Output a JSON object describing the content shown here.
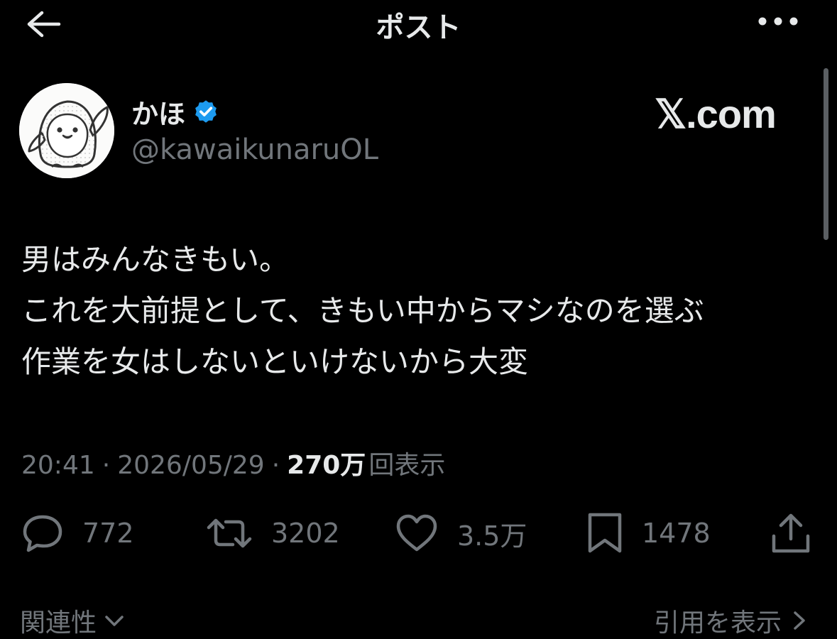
{
  "header": {
    "title": "ポスト",
    "back_icon": "arrow-left-icon",
    "more_icon": "more-horizontal-icon"
  },
  "author": {
    "display_name": "かほ",
    "handle": "@kawaikunaruOL",
    "verified_color": "#1d9bf0"
  },
  "watermark": "𝕏.com",
  "tweet": {
    "lines": [
      "男はみんなきもい。",
      "これを大前提として、きもい中からマシなのを選ぶ",
      "作業を女はしないといけないから大変"
    ]
  },
  "meta": {
    "time": "20:41",
    "separator": "·",
    "date": "2026/05/29",
    "views_count": "270万",
    "views_label": "回表示"
  },
  "actions": {
    "replies": "772",
    "reposts": "3202",
    "likes": "3.5万",
    "bookmarks": "1478"
  },
  "footer": {
    "related_label": "関連性",
    "quotes_label": "引用を表示"
  },
  "colors": {
    "background": "#000000",
    "text": "#e7e9ea",
    "secondary": "#71767b",
    "accent": "#1d9bf0"
  }
}
